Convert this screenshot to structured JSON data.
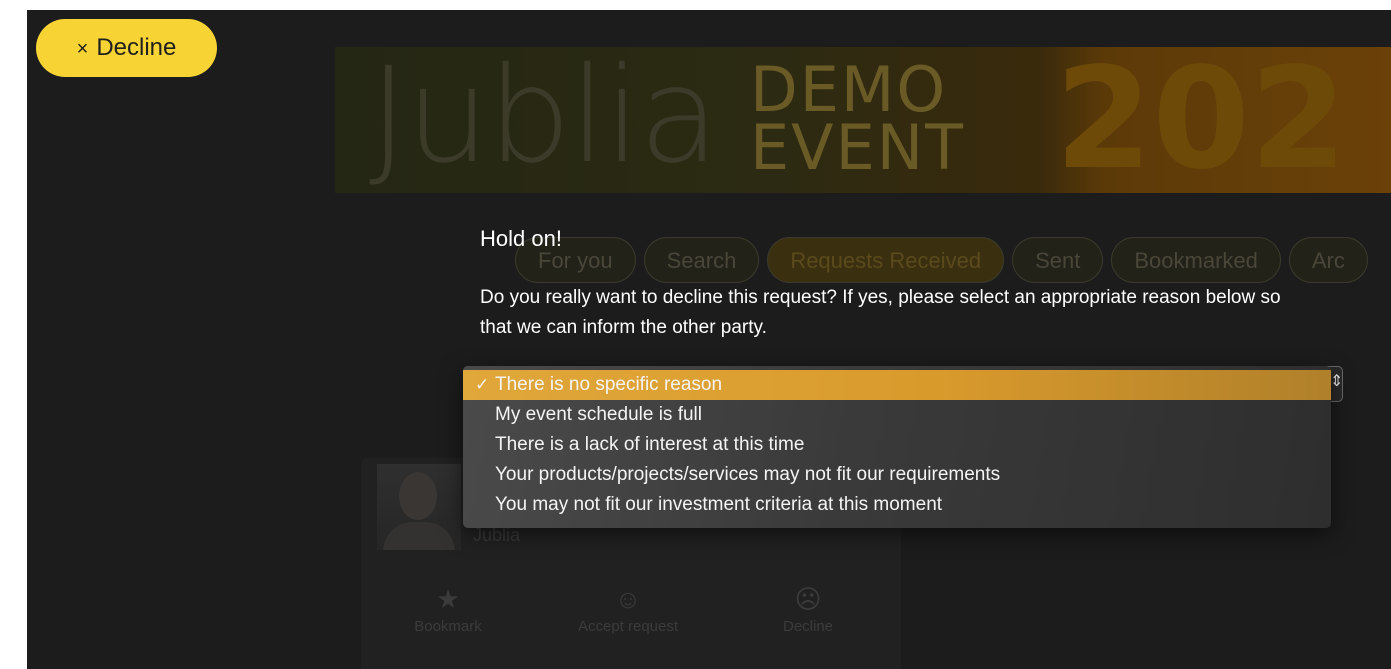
{
  "decline_button": {
    "icon": "×",
    "label": "Decline"
  },
  "banner": {
    "logo": "Jublia",
    "event_line1": "DEMO",
    "event_line2": "EVENT",
    "year": "202"
  },
  "tabs": [
    {
      "label": "For you"
    },
    {
      "label": "Search"
    },
    {
      "label": "Requests Received",
      "active": true
    },
    {
      "label": "Sent"
    },
    {
      "label": "Bookmarked"
    },
    {
      "label": "Arc"
    }
  ],
  "dialog": {
    "title": "Hold on!",
    "message": "Do you really want to decline this request? If yes, please select an appropriate reason below so that we can inform the other party."
  },
  "reason_select": {
    "selected_index": 0,
    "check_glyph": "✓",
    "arrow_glyph": "⇕",
    "options": [
      "There is no specific reason",
      "My event schedule is full",
      "There is a lack of interest at this time",
      "Your products/projects/services may not fit our requirements",
      "You may not fit our investment criteria at this moment"
    ]
  },
  "card": {
    "company": "Jublia",
    "actions": [
      {
        "icon": "★",
        "icon_name": "star-icon",
        "label": "Bookmark"
      },
      {
        "icon": "☺",
        "icon_name": "smile-icon",
        "label": "Accept request"
      },
      {
        "icon": "☹",
        "icon_name": "frown-icon",
        "label": "Decline"
      }
    ]
  },
  "colors": {
    "accent": "#f7d334",
    "highlight": "#e0a73a",
    "background": "#1c1c1c"
  }
}
